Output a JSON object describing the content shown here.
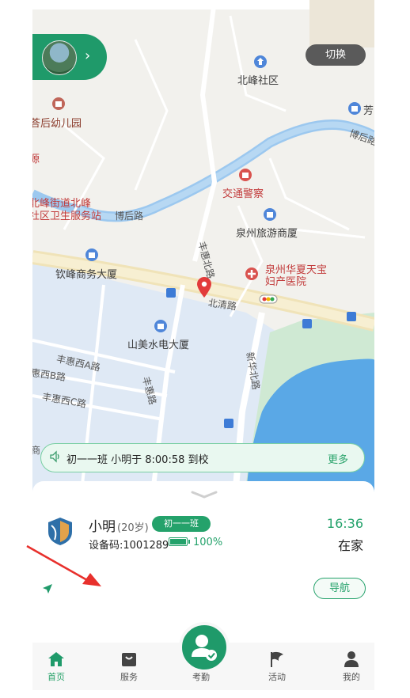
{
  "map": {
    "switch_label": "切换",
    "pois": {
      "beifeng_community": "北峰社区",
      "kindergarten": "荅后幼儿园",
      "fang": "芳",
      "traffic_police": "交通警察",
      "clinic_line1": "北峰街道北峰",
      "clinic_line2": "社区卫生服务站",
      "travel_mansion": "泉州旅游商厦",
      "hospital_line1": "泉州华夏天宝",
      "hospital_line2": "妇产医院",
      "qinfeng_mansion": "钦峰商务大厦",
      "shanmei_mansion": "山美水电大厦",
      "yuan": "源"
    },
    "roads": {
      "bohou_top": "博后路",
      "bohou_left": "博后路",
      "fenghui_north": "丰惠北路",
      "beiqing": "北清路",
      "fenghui_west_a": "丰惠西A路",
      "fenghui_west_b": "惠西B路",
      "fenghui_west_c": "丰惠西C路",
      "fenghui": "丰惠路",
      "xinhua_north": "新华北路",
      "shang": "商"
    }
  },
  "notice": {
    "text": "初一一班 小明于 8:00:58 到校",
    "more": "更多"
  },
  "student": {
    "name": "小明",
    "age": "(20岁)",
    "class": "初一一班",
    "device": "设备码:1001289",
    "battery_percent": "100%",
    "battery_level": 1.0,
    "time": "16:36",
    "status": "在家"
  },
  "navigate_label": "导航",
  "tabs": [
    {
      "label": "首页",
      "active": true
    },
    {
      "label": "服务",
      "active": false
    },
    {
      "label": "考勤",
      "active": false
    },
    {
      "label": "活动",
      "active": false
    },
    {
      "label": "我的",
      "active": false
    }
  ],
  "colors": {
    "accent": "#24a26b",
    "marker": "#e23b3b"
  }
}
